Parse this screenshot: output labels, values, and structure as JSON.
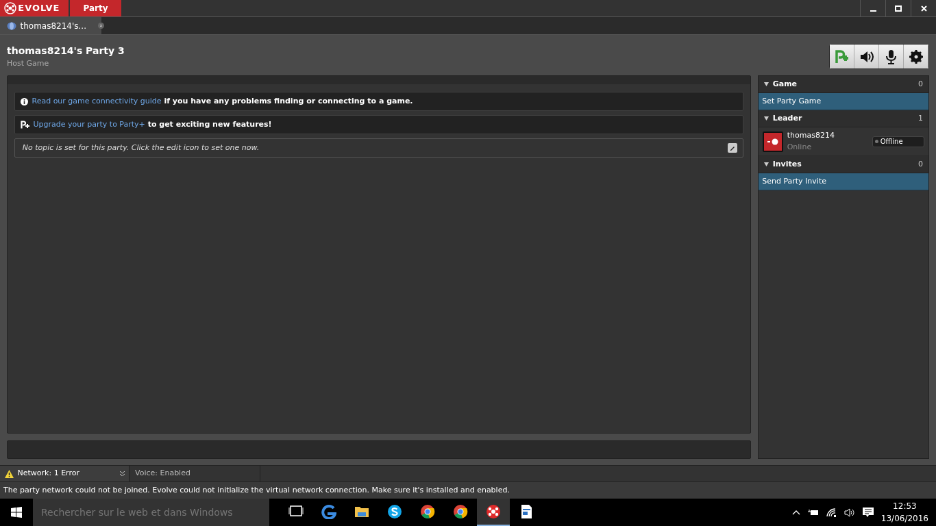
{
  "app": {
    "logo": "EVOLVE"
  },
  "top_tabs": [
    {
      "label": "Party",
      "selected": true
    }
  ],
  "doc_tabs": [
    {
      "label": "thomas8214's...",
      "selected": true
    }
  ],
  "header": {
    "title": "thomas8214's Party 3",
    "subtitle": "Host Game"
  },
  "toolbar": [
    {
      "kind": "party-plus"
    },
    {
      "kind": "speaker"
    },
    {
      "kind": "mic"
    },
    {
      "kind": "settings"
    }
  ],
  "messages": [
    {
      "kind": "info",
      "link": "Read our game connectivity guide",
      "text": "if you have any problems finding or connecting to a game."
    },
    {
      "kind": "upgrade",
      "link": "Upgrade your party to Party+",
      "text": "to get exciting new features!"
    },
    {
      "kind": "topic",
      "text": "No topic is set for this party. Click the edit icon to set one now."
    }
  ],
  "sidebar": {
    "sections": [
      {
        "title": "Game",
        "count": "0",
        "expanded": true,
        "action": "Set Party Game"
      },
      {
        "title": "Leader",
        "count": "1",
        "expanded": true,
        "members": [
          {
            "name": "thomas8214",
            "status": "Online",
            "badge": "Offline"
          }
        ]
      },
      {
        "title": "Invites",
        "count": "0",
        "expanded": true,
        "action": "Send Party Invite"
      }
    ]
  },
  "status_bar": {
    "network": "Network: 1 Error",
    "voice": "Voice: Enabled",
    "message": "The party network could not be joined. Evolve could not initialize the virtual network connection. Make sure it's installed and enabled."
  },
  "taskbar": {
    "search_placeholder": "Rechercher sur le web et dans Windows",
    "apps": [
      {
        "kind": "taskview",
        "selected": false
      },
      {
        "kind": "browser",
        "selected": false
      },
      {
        "kind": "folder",
        "selected": false
      },
      {
        "kind": "chat",
        "selected": false
      },
      {
        "kind": "chrome",
        "selected": false
      },
      {
        "kind": "chrome",
        "selected": false
      },
      {
        "kind": "evolve",
        "selected": true
      },
      {
        "kind": "document",
        "selected": false
      }
    ],
    "time": "12:53",
    "date": "13/06/2016"
  }
}
